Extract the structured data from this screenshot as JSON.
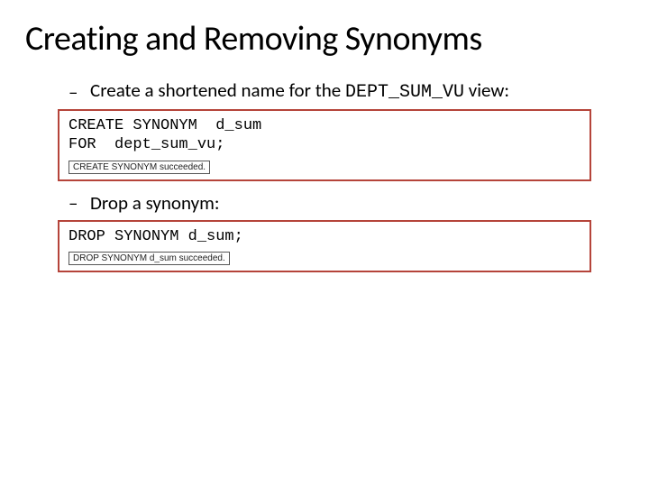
{
  "title": "Creating and Removing Synonyms",
  "bullets": {
    "b1_pre": "Create a shortened name for the ",
    "b1_code": "DEPT_SUM_VU",
    "b1_post": " view:",
    "b2": "Drop a synonym:"
  },
  "codebox1": {
    "sql": "CREATE SYNONYM  d_sum\nFOR  dept_sum_vu;",
    "result": "CREATE SYNONYM succeeded."
  },
  "codebox2": {
    "sql": "DROP SYNONYM d_sum;",
    "result": "DROP SYNONYM d_sum succeeded."
  }
}
